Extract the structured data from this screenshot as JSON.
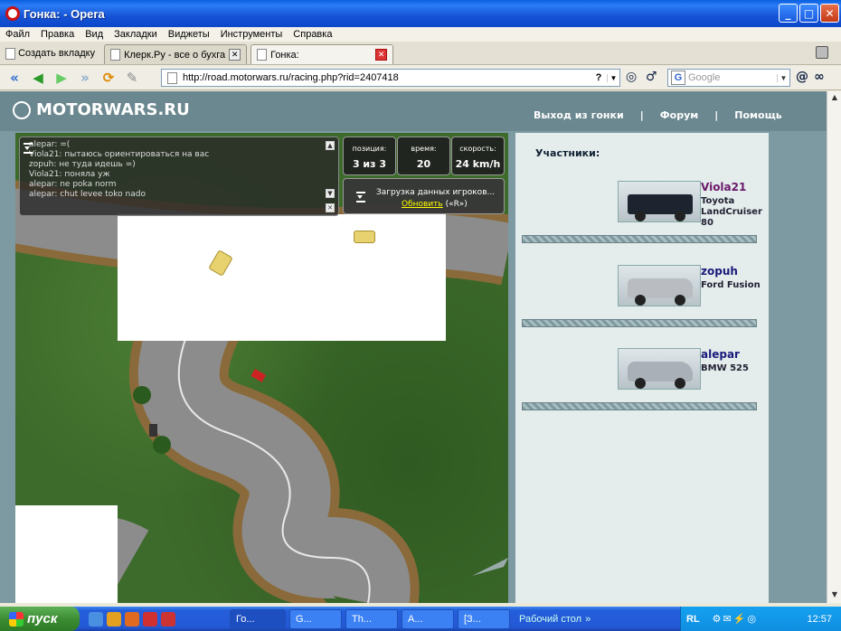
{
  "window": {
    "title": "Гонка: - Opera"
  },
  "menu": [
    "Файл",
    "Правка",
    "Вид",
    "Закладки",
    "Виджеты",
    "Инструменты",
    "Справка"
  ],
  "tabs": {
    "new_tab_label": "Создать вкладку",
    "items": [
      {
        "label": "Клерк.Ру - все о бухга..."
      },
      {
        "label": "Гонка:"
      }
    ]
  },
  "address": {
    "url": "http://road.motorwars.ru/racing.php?rid=2407418",
    "help_glyph": "?",
    "search_placeholder": "Google"
  },
  "site": {
    "logo": "MOTORWARS.RU",
    "links": [
      "Выход из гонки",
      "Форум",
      "Помощь"
    ],
    "separator": "|"
  },
  "chat": [
    {
      "text": "alepar: =("
    },
    {
      "text": "Viola21: пытаюсь ориентироваться на вас"
    },
    {
      "text": "zopuh: не туда идешь =)"
    },
    {
      "text": "Viola21: поняла уж"
    },
    {
      "text": "alepar: ne poka norm"
    },
    {
      "text": "alepar: chut levee toko nado"
    }
  ],
  "hud": {
    "position_label": "позиция:",
    "position_value": "3 из 3",
    "time_label": "время:",
    "time_value": "20",
    "speed_label": "скорость:",
    "speed_value": "24 km/h",
    "loading_text": "Загрузка данных игроков...",
    "refresh_link": "Обновить",
    "refresh_hint": "(«R»)"
  },
  "participants": {
    "title": "Участники:",
    "items": [
      {
        "name": "Viola21",
        "model": "Toyota LandCruiser 80",
        "name_color": "#6b1a6b"
      },
      {
        "name": "zopuh",
        "model": "Ford Fusion",
        "name_color": "#1a1a7a"
      },
      {
        "name": "alepar",
        "model": "BMW 525",
        "name_color": "#1a1a7a"
      }
    ]
  },
  "taskbar": {
    "start_label": "пуск",
    "tasks": [
      "Го...",
      "G...",
      "Th...",
      "A...",
      "[З..."
    ],
    "desktop_label": "Рабочий стол",
    "chevron": "»",
    "lang": "RL",
    "clock": "12:57"
  }
}
